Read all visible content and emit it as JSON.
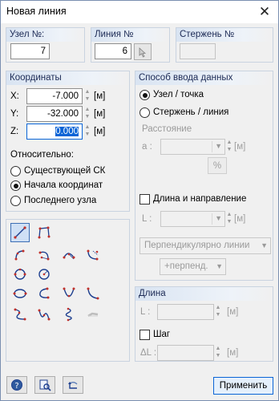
{
  "window": {
    "title": "Новая линия"
  },
  "node_no": {
    "label": "Узел №:",
    "value": "7"
  },
  "line_no": {
    "label": "Линия №",
    "value": "6"
  },
  "member_no": {
    "label": "Стержень №",
    "value": ""
  },
  "coords": {
    "header": "Координаты",
    "x": {
      "label": "X:",
      "value": "-7.000",
      "unit": "[м]"
    },
    "y": {
      "label": "Y:",
      "value": "-32.000",
      "unit": "[м]"
    },
    "z": {
      "label": "Z:",
      "value": "0.000",
      "unit": "[м]"
    },
    "relative_label": "Относительно:",
    "options": [
      "Существующей СК",
      "Начала координат",
      "Последнего узла"
    ],
    "selected": "Начала координат"
  },
  "input_method": {
    "header": "Способ ввода данных",
    "opt_node": "Узел / точка",
    "opt_member": "Стержень / линия",
    "selected": "Узел / точка",
    "distance_label": "Расстояние",
    "a_label": "a :",
    "a_unit": "[м]",
    "percent": "%",
    "length_dir_label": "Длина и направление",
    "l_label": "L :",
    "l_unit": "[м]",
    "perpendicular_combo": "Перпендикулярно линии",
    "perp_combo2": "+перпенд."
  },
  "length": {
    "header": "Длина",
    "l_label": "L :",
    "l_unit": "[м]",
    "step_label": "Шаг",
    "dl_label": "ΔL :",
    "dl_unit": "[м]"
  },
  "footer": {
    "apply_label": "Применить"
  },
  "colors": {
    "accent": "#0a64d6",
    "group_header": "#d9e4f2",
    "icon_red": "#c0302a",
    "icon_blue": "#1d3f8f"
  }
}
